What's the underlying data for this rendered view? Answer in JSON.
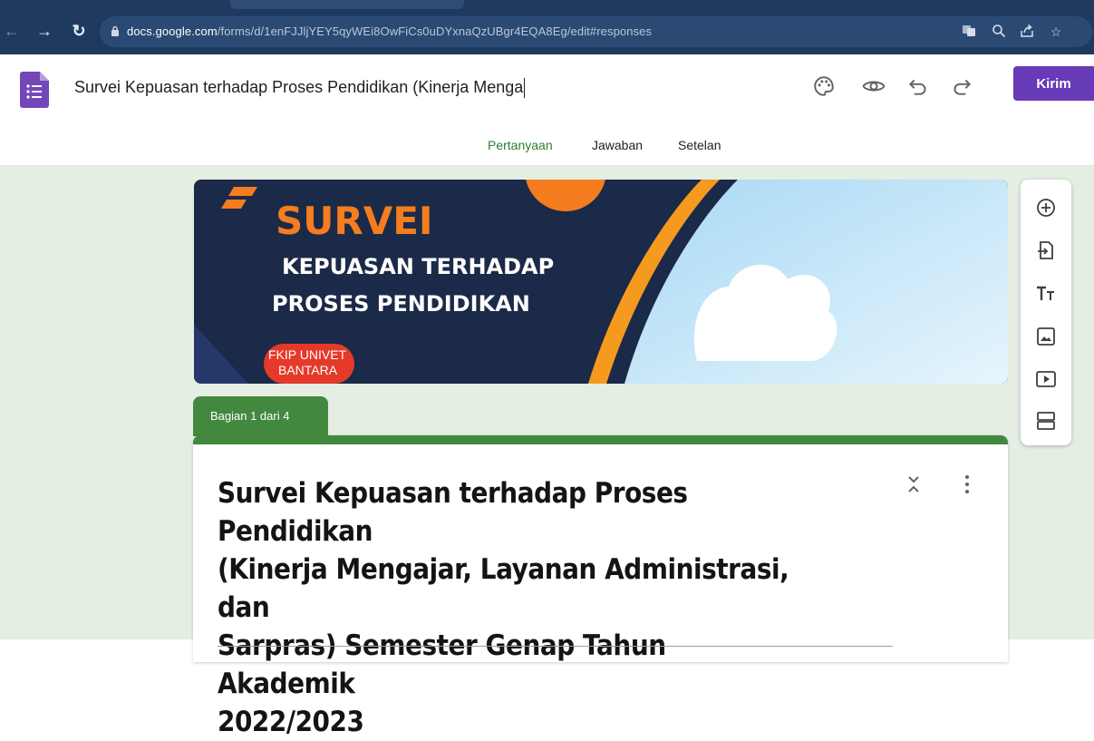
{
  "browser": {
    "url_host": "docs.google.com",
    "url_path": "/forms/d/1enFJJljYEY5qyWEi8OwFiCs0uDYxnaQzUBgr4EQA8Eg/edit#responses"
  },
  "header": {
    "title": "Survei Kepuasan terhadap Proses Pendidikan (Kinerja Menga",
    "send_label": "Kirim"
  },
  "tabs": [
    {
      "label": "Pertanyaan",
      "active": true
    },
    {
      "label": "Jawaban",
      "active": false
    },
    {
      "label": "Setelan",
      "active": false
    }
  ],
  "banner": {
    "headline": "SURVEI",
    "line1": "KEPUASAN TERHADAP",
    "line2": "PROSES PENDIDIKAN",
    "badge_line1": "FKIP UNIVET",
    "badge_line2": "BANTARA"
  },
  "section": {
    "label": "Bagian 1 dari 4"
  },
  "form": {
    "title_line1": "Survei Kepuasan terhadap Proses Pendidikan",
    "title_line2": "(Kinerja Mengajar, Layanan Administrasi, dan",
    "title_line3": "Sarpras) Semester Genap Tahun Akademik",
    "title_line4": "2022/2023"
  },
  "toolbar": {
    "items": [
      "add-question",
      "import-questions",
      "add-title",
      "add-image",
      "add-video",
      "add-section"
    ]
  },
  "colors": {
    "accent": "#673ab7",
    "theme_green": "#43883f",
    "canvas_bg": "#e4eee3",
    "banner_navy": "#1b2a48",
    "banner_orange": "#f57c1f"
  }
}
